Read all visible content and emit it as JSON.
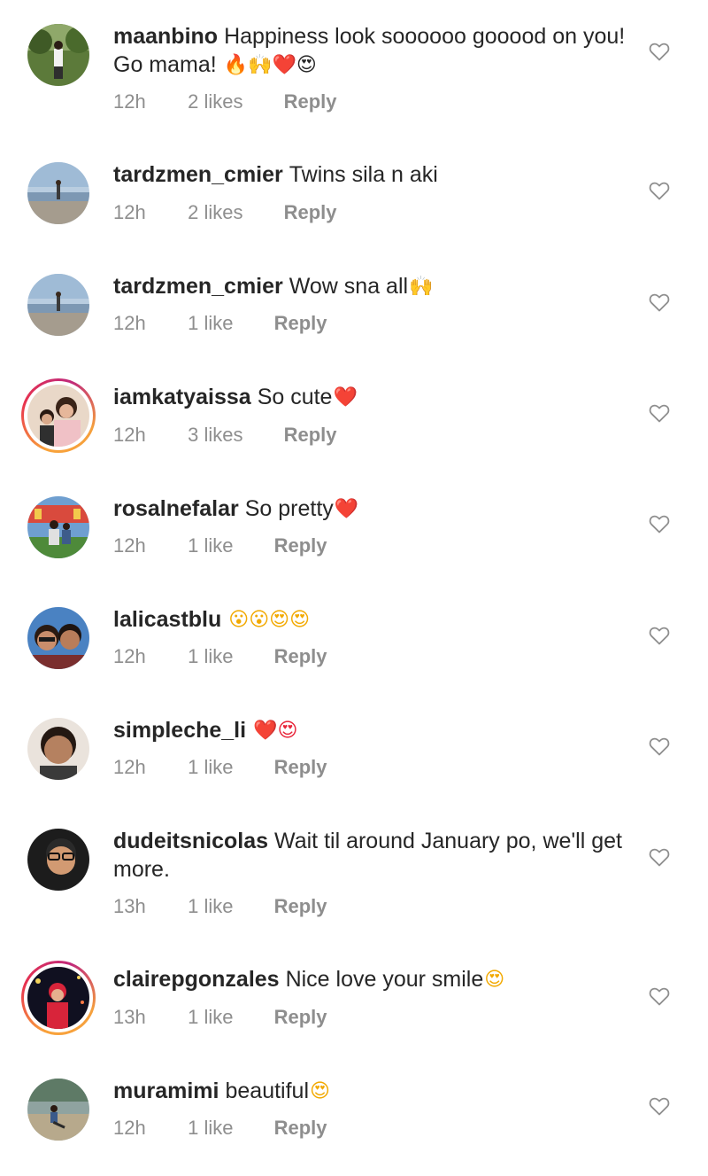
{
  "comments": [
    {
      "username": "maanbino",
      "text": "Happiness look soooooo gooood on you! Go mama!",
      "emojis": "🔥🙌❤️😍",
      "time": "12h",
      "likes": "2 likes",
      "reply": "Reply"
    },
    {
      "username": "tardzmen_cmier",
      "text": "Twins sila n aki",
      "emojis": "",
      "time": "12h",
      "likes": "2 likes",
      "reply": "Reply"
    },
    {
      "username": "tardzmen_cmier",
      "text": "Wow sna all",
      "emojis": "🙌",
      "time": "12h",
      "likes": "1 like",
      "reply": "Reply"
    },
    {
      "username": "iamkatyaissa",
      "text": "So cute",
      "emojis": "❤️",
      "time": "12h",
      "likes": "3 likes",
      "reply": "Reply"
    },
    {
      "username": "rosalnefalar",
      "text": "So pretty",
      "emojis": "❤️",
      "time": "12h",
      "likes": "1 like",
      "reply": "Reply"
    },
    {
      "username": "lalicastblu",
      "text": "",
      "emojis": "😮😮😍😍",
      "time": "12h",
      "likes": "1 like",
      "reply": "Reply"
    },
    {
      "username": "simpleche_li",
      "text": "",
      "emojis": "❤️😍",
      "time": "12h",
      "likes": "1 like",
      "reply": "Reply"
    },
    {
      "username": "dudeitsnicolas",
      "text": "Wait til around January po, we'll get more.",
      "emojis": "",
      "time": "13h",
      "likes": "1 like",
      "reply": "Reply"
    },
    {
      "username": "clairepgonzales",
      "text": "Nice love your smile",
      "emojis": "😍",
      "time": "13h",
      "likes": "1 like",
      "reply": "Reply"
    },
    {
      "username": "muramimi",
      "text": "beautiful",
      "emojis": "😍",
      "time": "12h",
      "likes": "1 like",
      "reply": "Reply"
    }
  ],
  "icons": {
    "like": "heart-outline-icon"
  },
  "colors": {
    "text_primary": "#262626",
    "text_secondary": "#8e8e8e",
    "story_ring_start": "#f9a23a",
    "story_ring_end": "#c0287a"
  }
}
